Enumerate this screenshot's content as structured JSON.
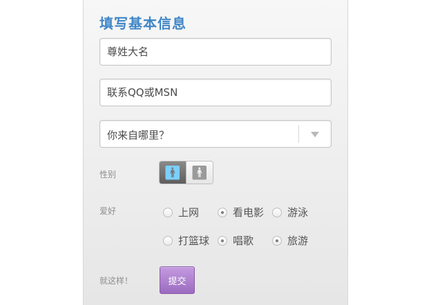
{
  "form": {
    "title": "填写基本信息",
    "name_placeholder": "尊姓大名",
    "contact_placeholder": "联系QQ或MSN",
    "origin_select": {
      "selected": "你来自哪里？"
    },
    "gender": {
      "label": "性别",
      "selected": "male"
    },
    "hobbies": {
      "label": "爱好",
      "options": [
        {
          "label": "上网",
          "checked": false
        },
        {
          "label": "看电影",
          "checked": true
        },
        {
          "label": "游泳",
          "checked": false
        },
        {
          "label": "打篮球",
          "checked": false
        },
        {
          "label": "唱歌",
          "checked": true
        },
        {
          "label": "旅游",
          "checked": true
        }
      ]
    },
    "submit": {
      "prompt": "就这样！",
      "label": "提交"
    }
  },
  "colors": {
    "title": "#3f86c7",
    "submit_button": "#ad80cf",
    "gender_active": "#6f6f6f"
  }
}
